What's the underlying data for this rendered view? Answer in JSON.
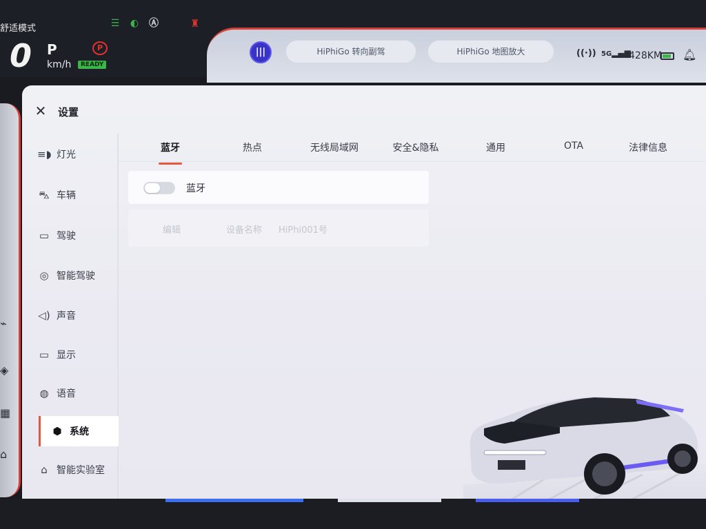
{
  "status_bar": {
    "mode": "舒适模式",
    "speed": "0",
    "gear": "P",
    "unit": "km/h",
    "ready": "READY",
    "parking_glyph": "P",
    "hiphi_badge": "|||",
    "pill_left": "HiPhiGo 转向副驾",
    "pill_right": "HiPhiGo 地图放大",
    "network": "5G",
    "range": "428KM",
    "icons": [
      "fog-light-icon",
      "low-beam-icon",
      "auto-light-icon",
      "seatbelt-warning-icon",
      "parking-brake-icon",
      "wireless-icon",
      "signal-icon",
      "battery-icon",
      "bell-icon"
    ],
    "colors": {
      "green": "#3bb54a",
      "red": "#e0322f",
      "brand": "#3a33c8"
    }
  },
  "panel": {
    "title": "设置",
    "sidebar": [
      {
        "label": "灯光",
        "icon": "light-icon"
      },
      {
        "label": "车辆",
        "icon": "car-icon"
      },
      {
        "label": "驾驶",
        "icon": "steering-icon"
      },
      {
        "label": "智能驾驶",
        "icon": "smart-drive-icon"
      },
      {
        "label": "声音",
        "icon": "speaker-icon"
      },
      {
        "label": "显示",
        "icon": "display-icon"
      },
      {
        "label": "语音",
        "icon": "voice-icon"
      },
      {
        "label": "系统",
        "icon": "cube-icon",
        "active": true
      },
      {
        "label": "智能实验室",
        "icon": "ai-lab-icon"
      }
    ],
    "tabs": [
      {
        "label": "蓝牙",
        "active": true
      },
      {
        "label": "热点"
      },
      {
        "label": "无线局域网"
      },
      {
        "label": "安全&隐私"
      },
      {
        "label": "通用"
      },
      {
        "label": "OTA"
      },
      {
        "label": "法律信息"
      }
    ],
    "bluetooth": {
      "label": "蓝牙",
      "enabled": false,
      "edit_label": "编辑",
      "device_name_label": "设备名称",
      "device_name": "HiPhi001号"
    },
    "accent": "#e8563a"
  }
}
